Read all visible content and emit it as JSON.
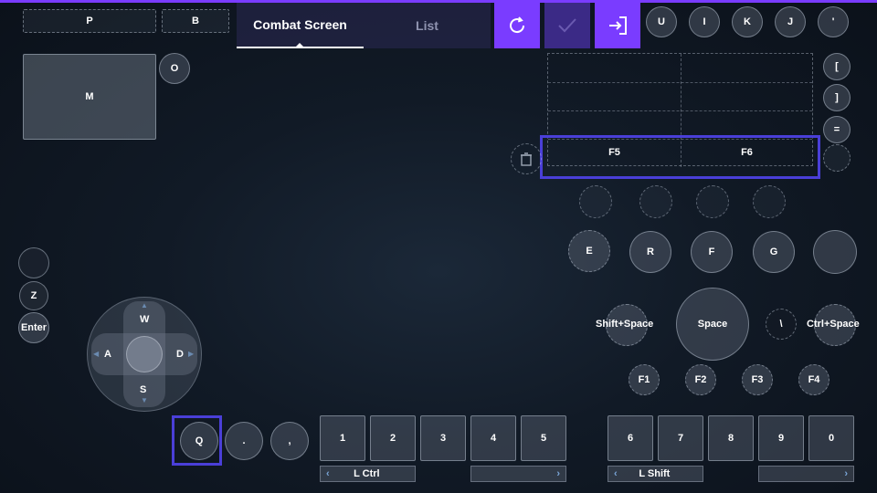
{
  "colors": {
    "accent": "#7a3cff",
    "highlight": "#4a3fd8",
    "button_bg": "#5a6473"
  },
  "tabs": {
    "active": "Combat Screen",
    "inactive": "List"
  },
  "actions": {
    "reset_icon": "reset-icon",
    "confirm_icon": "check-icon",
    "exit_icon": "exit-icon"
  },
  "top_left": {
    "p": "P",
    "b": "B",
    "m": "M",
    "o": "O"
  },
  "top_right_keys": [
    "U",
    "I",
    "K",
    "J",
    "'"
  ],
  "right_column": {
    "bracket_open": "[",
    "bracket_close": "]",
    "equals": "="
  },
  "fkeys_table": {
    "f5": "F5",
    "f6": "F6"
  },
  "skills": {
    "e": "E",
    "r": "R",
    "f": "F",
    "g": "G"
  },
  "left_side": {
    "z": "Z",
    "enter": "Enter"
  },
  "dpad": {
    "up": "W",
    "left": "A",
    "right": "D",
    "down": "S"
  },
  "jump": {
    "shift_space": "Shift+Space",
    "space": "Space",
    "backslash": "\\",
    "ctrl_space": "Ctrl+Space"
  },
  "function_keys": [
    "F1",
    "F2",
    "F3",
    "F4"
  ],
  "bottom_left": {
    "q": "Q",
    "period": ".",
    "comma": ","
  },
  "hotbar_left": [
    "1",
    "2",
    "3",
    "4",
    "5"
  ],
  "hotbar_right": [
    "6",
    "7",
    "8",
    "9",
    "0"
  ],
  "modifiers": {
    "left": "L Ctrl",
    "right": "L Shift"
  }
}
